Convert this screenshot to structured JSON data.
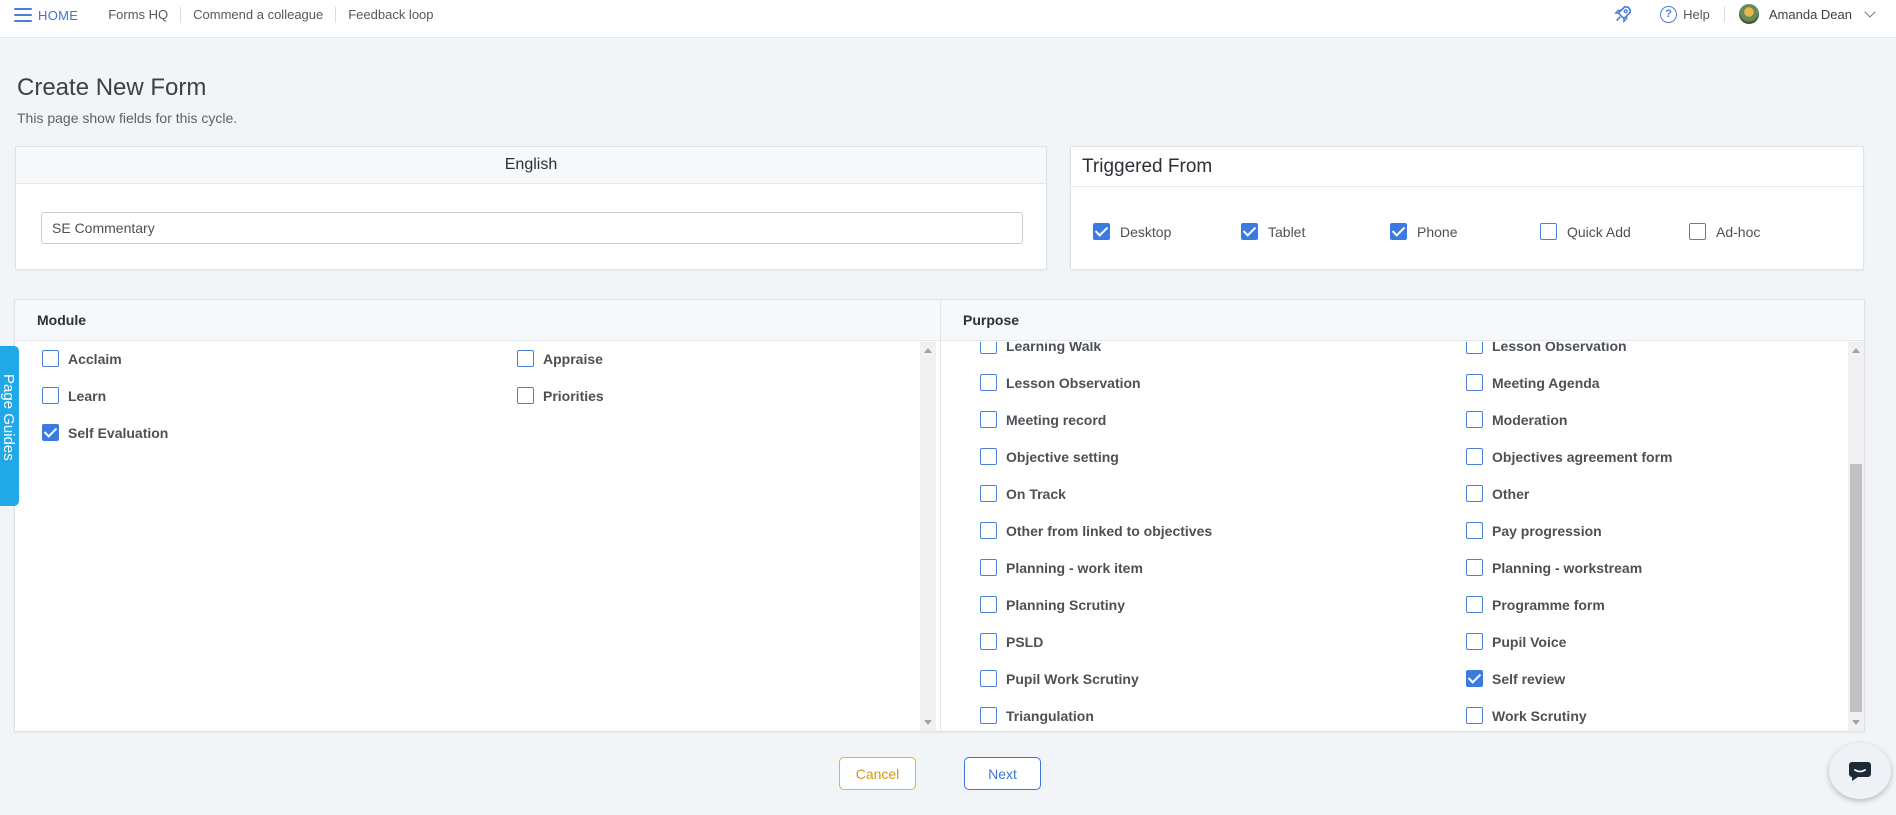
{
  "nav": {
    "home": "HOME",
    "links": [
      "Forms HQ",
      "Commend a colleague",
      "Feedback loop"
    ],
    "help": "Help",
    "user": "Amanda Dean"
  },
  "header": {
    "title": "Create New Form",
    "subtitle": "This page show fields for this cycle."
  },
  "language": {
    "label": "English",
    "form_name": "SE Commentary"
  },
  "triggered": {
    "title": "Triggered From",
    "options": [
      {
        "label": "Desktop",
        "checked": true
      },
      {
        "label": "Tablet",
        "checked": true
      },
      {
        "label": "Phone",
        "checked": true
      },
      {
        "label": "Quick Add",
        "checked": false
      },
      {
        "label": "Ad-hoc",
        "checked": false
      }
    ]
  },
  "module": {
    "title": "Module",
    "options": [
      {
        "label": "Acclaim",
        "checked": false
      },
      {
        "label": "Appraise",
        "checked": false
      },
      {
        "label": "Learn",
        "checked": false
      },
      {
        "label": "Priorities",
        "checked": false
      },
      {
        "label": "Self Evaluation",
        "checked": true
      }
    ]
  },
  "purpose": {
    "title": "Purpose",
    "options": [
      {
        "label": "Learning Walk",
        "checked": false
      },
      {
        "label": "Lesson Observation",
        "checked": false
      },
      {
        "label": "Lesson Observation",
        "checked": false
      },
      {
        "label": "Meeting Agenda",
        "checked": false
      },
      {
        "label": "Meeting record",
        "checked": false
      },
      {
        "label": "Moderation",
        "checked": false
      },
      {
        "label": "Objective setting",
        "checked": false
      },
      {
        "label": "Objectives agreement form",
        "checked": false
      },
      {
        "label": "On Track",
        "checked": false
      },
      {
        "label": "Other",
        "checked": false
      },
      {
        "label": "Other from linked to objectives",
        "checked": false
      },
      {
        "label": "Pay progression",
        "checked": false
      },
      {
        "label": "Planning - work item",
        "checked": false
      },
      {
        "label": "Planning - workstream",
        "checked": false
      },
      {
        "label": "Planning Scrutiny",
        "checked": false
      },
      {
        "label": "Programme form",
        "checked": false
      },
      {
        "label": "PSLD",
        "checked": false
      },
      {
        "label": "Pupil Voice",
        "checked": false
      },
      {
        "label": "Pupil Work Scrutiny",
        "checked": false
      },
      {
        "label": "Self review",
        "checked": true
      },
      {
        "label": "Triangulation",
        "checked": false
      },
      {
        "label": "Work Scrutiny",
        "checked": false
      }
    ]
  },
  "guides_label": "Page Guides",
  "buttons": {
    "cancel": "Cancel",
    "next": "Next"
  }
}
